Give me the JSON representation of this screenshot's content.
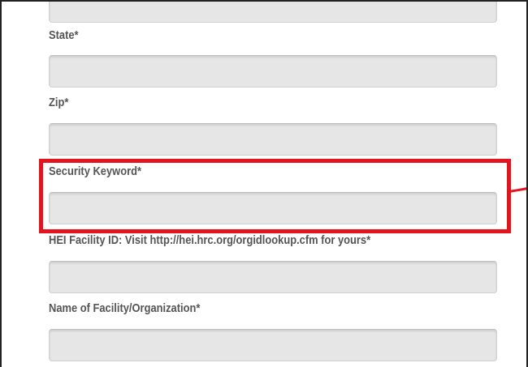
{
  "form": {
    "fields": [
      {
        "label": "",
        "value": ""
      },
      {
        "label": "State*",
        "value": ""
      },
      {
        "label": "Zip*",
        "value": ""
      },
      {
        "label": "Security Keyword*",
        "value": ""
      },
      {
        "label": "HEI Facility ID: Visit http://hei.hrc.org/orgidlookup.cfm for yours*",
        "value": ""
      },
      {
        "label": "Name of Facility/Organization*",
        "value": ""
      }
    ]
  },
  "annotation": {
    "highlight_color": "#e3141e",
    "highlighted_field": "Security Keyword*"
  }
}
